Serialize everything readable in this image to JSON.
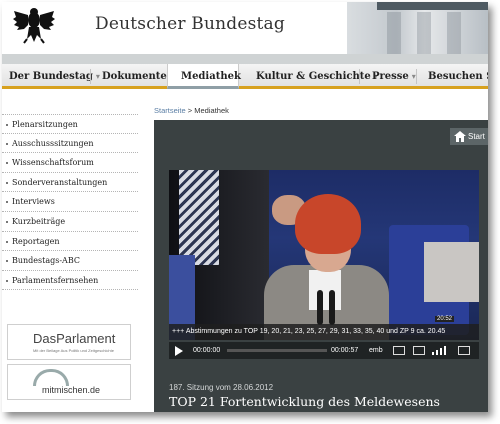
{
  "header": {
    "title": "Deutscher Bundestag",
    "logo_icon": "federal-eagle-icon"
  },
  "nav": {
    "items": [
      {
        "label": "Der Bundestag",
        "has_dropdown": true,
        "active": false
      },
      {
        "label": "Dokumente",
        "has_dropdown": true,
        "active": false
      },
      {
        "label": "Mediathek",
        "has_dropdown": false,
        "active": true
      },
      {
        "label": "Kultur & Geschichte",
        "has_dropdown": true,
        "active": false
      },
      {
        "label": "Presse",
        "has_dropdown": true,
        "active": false
      },
      {
        "label": "Besuchen Sie",
        "has_dropdown": false,
        "active": false
      }
    ],
    "dropdown_glyph": "▾",
    "accent_color": "#d7a11f"
  },
  "breadcrumb": {
    "home": "Startseite",
    "separator": ">",
    "current": "Mediathek"
  },
  "sidebar": {
    "items": [
      {
        "label": "Plenarsitzungen"
      },
      {
        "label": "Ausschusssitzungen"
      },
      {
        "label": "Wissenschaftsforum"
      },
      {
        "label": "Sonderveranstaltungen"
      },
      {
        "label": "Interviews"
      },
      {
        "label": "Kurzbeiträge"
      },
      {
        "label": "Reportagen"
      },
      {
        "label": "Bundestags-ABC"
      },
      {
        "label": "Parlamentsfernsehen"
      }
    ],
    "promo1": {
      "name": "DasParlament",
      "tagline": "Mit der Beilage Aus Politik und Zeitgeschichte"
    },
    "promo2": {
      "name": "mitmischen.de"
    }
  },
  "media": {
    "start_label": "Start",
    "ticker": "+++ Abstimmungen zu TOP 19, 20, 21, 23, 25, 27, 29, 31, 33, 35, 40 und ZP 9 ca. 20.45",
    "overlay_time": "20:52",
    "current_time": "00:00:00",
    "duration": "00:00:57",
    "embed_label": "emb",
    "progress": 0,
    "session": "187. Sitzung vom 28.06.2012",
    "title": "TOP 21 Fortentwicklung des Meldewesens"
  }
}
